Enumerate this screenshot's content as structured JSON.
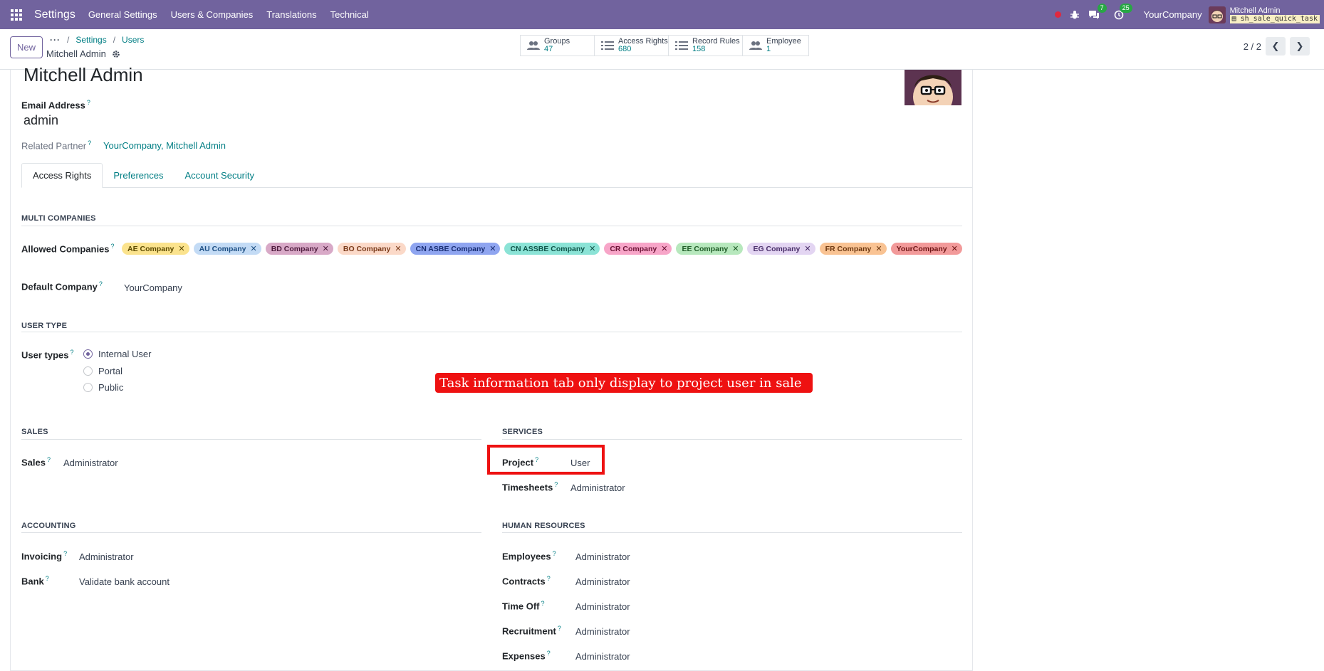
{
  "navbar": {
    "app_title": "Settings",
    "menu": [
      "General Settings",
      "Users & Companies",
      "Translations",
      "Technical"
    ],
    "chat_badge": "7",
    "activity_badge": "25",
    "company": "YourCompany",
    "user_name": "Mitchell Admin",
    "db_name": "sh_sale_quick_task"
  },
  "control": {
    "new_label": "New",
    "breadcrumb": [
      "Settings",
      "Users"
    ],
    "record_name": "Mitchell Admin",
    "smart_buttons": [
      {
        "label": "Groups",
        "count": "47",
        "icon": "users-icon"
      },
      {
        "label": "Access Rights",
        "count": "680",
        "icon": "list-icon"
      },
      {
        "label": "Record Rules",
        "count": "158",
        "icon": "list-icon"
      },
      {
        "label": "Employee",
        "count": "1",
        "icon": "users-icon"
      }
    ],
    "pager": "2 / 2"
  },
  "form": {
    "name": "Mitchell Admin",
    "email_label": "Email Address",
    "email_value": "admin",
    "partner_label": "Related Partner",
    "partner_value": "YourCompany, Mitchell Admin",
    "tabs": [
      "Access Rights",
      "Preferences",
      "Account Security"
    ],
    "multi_companies": {
      "title": "MULTI COMPANIES",
      "allowed_label": "Allowed Companies",
      "companies": [
        {
          "name": "AE Company",
          "bg": "#fbe38d",
          "fg": "#5c4a00"
        },
        {
          "name": "AU Company",
          "bg": "#c3dbf5",
          "fg": "#1d4f84"
        },
        {
          "name": "BD Company",
          "bg": "#d8a9c7",
          "fg": "#4f1c3e"
        },
        {
          "name": "BO Company",
          "bg": "#fbd9c8",
          "fg": "#7a3a1a"
        },
        {
          "name": "CN ASBE Company",
          "bg": "#8fa5f0",
          "fg": "#172c72"
        },
        {
          "name": "CN ASSBE Company",
          "bg": "#8be3d6",
          "fg": "#0e5449"
        },
        {
          "name": "CR Company",
          "bg": "#f7a5c8",
          "fg": "#6d1437"
        },
        {
          "name": "EE Company",
          "bg": "#b7e8bd",
          "fg": "#1e5b26"
        },
        {
          "name": "EG Company",
          "bg": "#e3d5f2",
          "fg": "#4a2f6b"
        },
        {
          "name": "FR Company",
          "bg": "#f9c393",
          "fg": "#6d3811"
        },
        {
          "name": "YourCompany",
          "bg": "#f29a9a",
          "fg": "#6e1515"
        }
      ],
      "default_label": "Default Company",
      "default_value": "YourCompany"
    },
    "user_type": {
      "title": "USER TYPE",
      "label": "User types",
      "options": [
        "Internal User",
        "Portal",
        "Public"
      ],
      "selected": "Internal User"
    },
    "annotation": "Task information tab only display to project user in sale",
    "sales": {
      "title": "SALES",
      "rows": [
        {
          "label": "Sales",
          "value": "Administrator"
        }
      ]
    },
    "services": {
      "title": "SERVICES",
      "rows": [
        {
          "label": "Project",
          "value": "User"
        },
        {
          "label": "Timesheets",
          "value": "Administrator"
        }
      ]
    },
    "accounting": {
      "title": "ACCOUNTING",
      "rows": [
        {
          "label": "Invoicing",
          "value": "Administrator"
        },
        {
          "label": "Bank",
          "value": "Validate bank account"
        }
      ]
    },
    "hr": {
      "title": "HUMAN RESOURCES",
      "rows": [
        {
          "label": "Employees",
          "value": "Administrator"
        },
        {
          "label": "Contracts",
          "value": "Administrator"
        },
        {
          "label": "Time Off",
          "value": "Administrator"
        },
        {
          "label": "Recruitment",
          "value": "Administrator"
        },
        {
          "label": "Expenses",
          "value": "Administrator"
        }
      ]
    }
  }
}
